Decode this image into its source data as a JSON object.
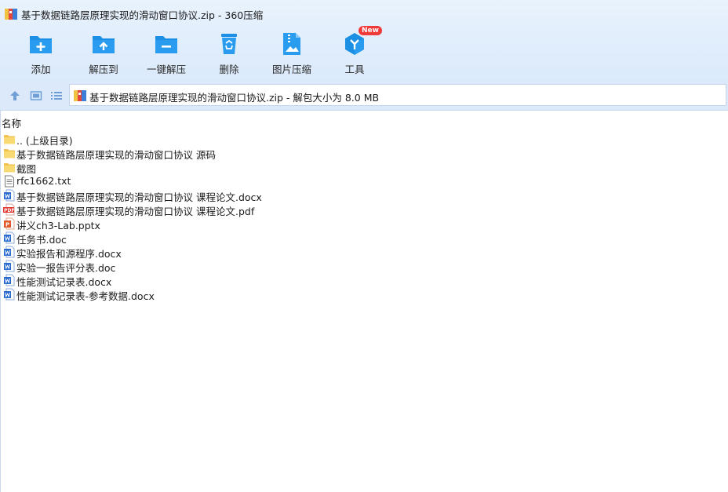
{
  "window": {
    "title": "基于数据链路层原理实现的滑动窗口协议.zip - 360压缩"
  },
  "toolbar": {
    "add_label": "添加",
    "extract_to_label": "解压到",
    "one_click_label": "一键解压",
    "delete_label": "删除",
    "image_compress_label": "图片压缩",
    "tools_label": "工具",
    "tools_badge": "New"
  },
  "nav": {
    "path": "基于数据链路层原理实现的滑动窗口协议.zip - 解包大小为 8.0 MB"
  },
  "list": {
    "header_name": "名称",
    "files": [
      {
        "name": ".. (上级目录)",
        "icon": "folder-icon"
      },
      {
        "name": "基于数据链路层原理实现的滑动窗口协议 源码",
        "icon": "folder-icon"
      },
      {
        "name": "截图",
        "icon": "folder-icon"
      },
      {
        "name": "rfc1662.txt",
        "icon": "text-file-icon"
      },
      {
        "name": "基于数据链路层原理实现的滑动窗口协议 课程论文.docx",
        "icon": "word-file-icon"
      },
      {
        "name": "基于数据链路层原理实现的滑动窗口协议 课程论文.pdf",
        "icon": "pdf-file-icon"
      },
      {
        "name": "讲义ch3-Lab.pptx",
        "icon": "powerpoint-file-icon"
      },
      {
        "name": "任务书.doc",
        "icon": "word-file-icon"
      },
      {
        "name": "实验报告和源程序.docx",
        "icon": "word-file-icon"
      },
      {
        "name": "实验一报告评分表.doc",
        "icon": "word-file-icon"
      },
      {
        "name": "性能测试记录表.docx",
        "icon": "word-file-icon"
      },
      {
        "name": "性能测试记录表-参考数据.docx",
        "icon": "word-file-icon"
      }
    ]
  },
  "colors": {
    "accent": "#1a8fe3",
    "toolbar_bg": "#dfedfc",
    "folder": "#f6d26b",
    "pdf": "#e0322b",
    "ppt": "#e2582b",
    "word": "#2a6bd1"
  }
}
